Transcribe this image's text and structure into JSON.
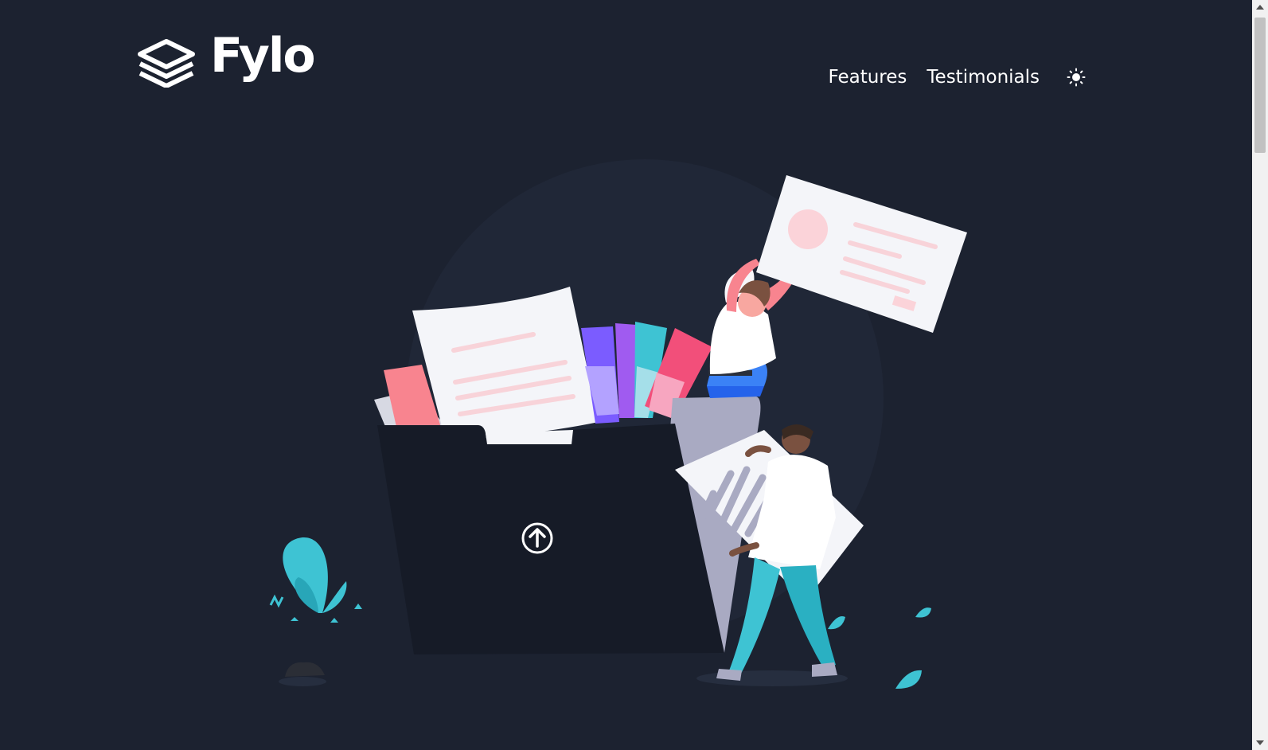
{
  "brand": {
    "name": "Fylo",
    "icon": "stacked-layers-icon"
  },
  "nav": {
    "items": [
      {
        "label": "Features"
      },
      {
        "label": "Testimonials"
      }
    ],
    "theme_toggle_icon": "sun-icon"
  },
  "hero": {
    "illustration_icon": "upload-arrow-icon"
  },
  "colors": {
    "background": "#1c2230",
    "text": "#ffffff",
    "accent_teal": "#3ec3d3",
    "accent_pink": "#f8848f"
  }
}
